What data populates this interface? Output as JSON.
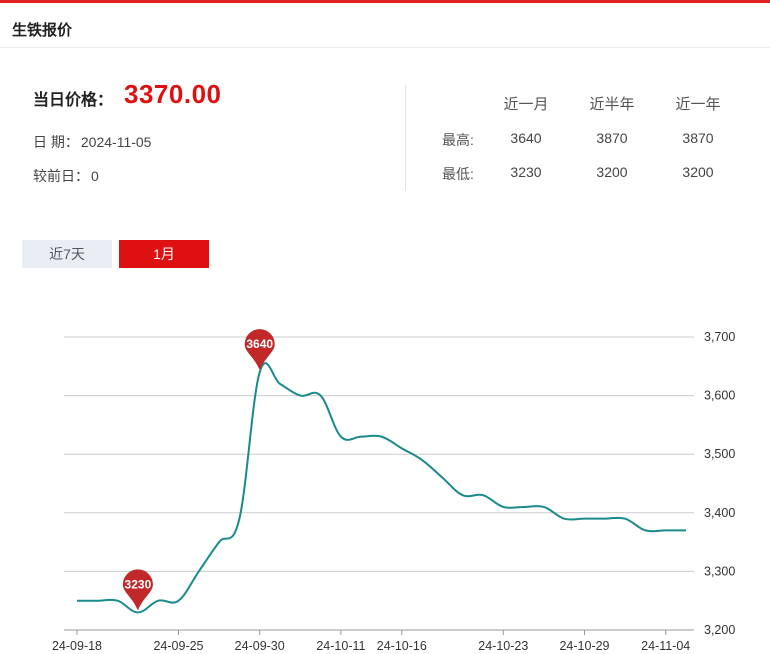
{
  "header": {
    "title": "生铁报价"
  },
  "price": {
    "label": "当日价格：",
    "value": "3370.00"
  },
  "info": {
    "date_label": "日 期：",
    "date_value": "2024-11-05",
    "change_label": "较前日：",
    "change_value": "0"
  },
  "stats": {
    "columns": [
      "近一月",
      "近半年",
      "近一年"
    ],
    "high_label": "最高:",
    "low_label": "最低:",
    "high": [
      "3640",
      "3870",
      "3870"
    ],
    "low": [
      "3230",
      "3200",
      "3200"
    ]
  },
  "tabs": [
    {
      "label": "近7天",
      "active": false
    },
    {
      "label": "1月",
      "active": true
    }
  ],
  "colors": {
    "accent": "#dd1111",
    "line": "#1a8a8a",
    "pin": "#c0282a",
    "grid": "#cccccc"
  },
  "chart_data": {
    "type": "line",
    "x": [
      "24-09-18",
      "24-09-19",
      "24-09-20",
      "24-09-23",
      "24-09-24",
      "24-09-25",
      "24-09-26",
      "24-09-27",
      "24-09-29",
      "24-09-30",
      "24-10-08",
      "24-10-09",
      "24-10-10",
      "24-10-11",
      "24-10-14",
      "24-10-15",
      "24-10-16",
      "24-10-17",
      "24-10-18",
      "24-10-21",
      "24-10-22",
      "24-10-23",
      "24-10-24",
      "24-10-25",
      "24-10-28",
      "24-10-29",
      "24-10-30",
      "24-10-31",
      "24-11-01",
      "24-11-04",
      "24-11-05"
    ],
    "xticks": [
      "24-09-18",
      "24-09-25",
      "24-09-30",
      "24-10-11",
      "24-10-16",
      "24-10-23",
      "24-10-29",
      "24-11-04"
    ],
    "series": [
      {
        "values": [
          3250,
          3250,
          3250,
          3230,
          3250,
          3250,
          3300,
          3350,
          3390,
          3640,
          3620,
          3600,
          3600,
          3530,
          3530,
          3530,
          3510,
          3490,
          3460,
          3430,
          3430,
          3410,
          3410,
          3410,
          3390,
          3390,
          3390,
          3390,
          3370,
          3370,
          3370
        ]
      }
    ],
    "ylim": [
      3200,
      3700
    ],
    "yticks": [
      "3,700",
      "3,600",
      "3,500",
      "3,400",
      "3,300",
      "3,200"
    ],
    "markers": [
      {
        "label": "3640",
        "x": "24-09-30",
        "y": 3640
      },
      {
        "label": "3230",
        "x": "24-09-23",
        "y": 3230
      }
    ]
  }
}
